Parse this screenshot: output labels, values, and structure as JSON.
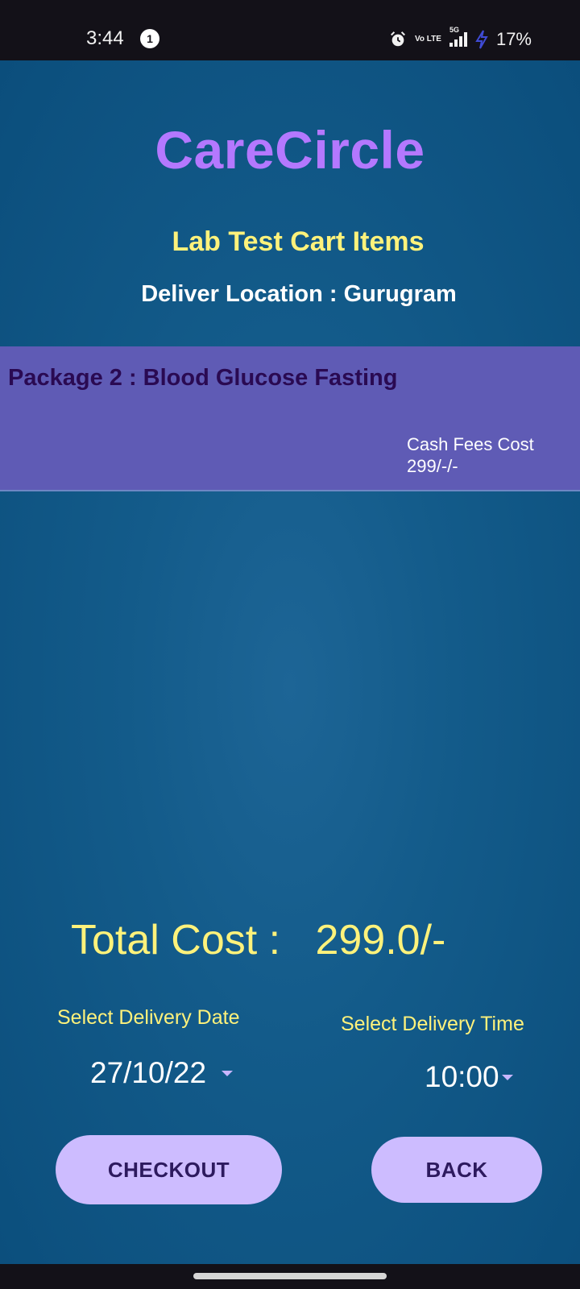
{
  "status_bar": {
    "time": "3:44",
    "notification_count": "1",
    "network_label": "5G",
    "volte_label": "Vo LTE",
    "battery": "17%"
  },
  "app": {
    "title": "CareCircle",
    "subtitle": "Lab Test Cart Items",
    "location": "Deliver Location : Gurugram"
  },
  "cart": {
    "items": [
      {
        "name": "Package 2 : Blood Glucose Fasting",
        "cost_label": "Cash Fees Cost",
        "cost_value": "299/-/-"
      }
    ]
  },
  "summary": {
    "total": "Total Cost :   299.0/-"
  },
  "delivery": {
    "date_label": "Select Delivery Date",
    "date_value": "27/10/22",
    "time_label": "Select Delivery Time",
    "time_value": "10:00"
  },
  "actions": {
    "checkout_label": "CHECKOUT",
    "back_label": "BACK"
  },
  "colors": {
    "title": "#b478ff",
    "accent_yellow": "#fff27b",
    "cart_item_bg": "#5f5bb5",
    "button_bg": "#cdbcff",
    "button_text": "#2d1a5e",
    "background": "#135b8a"
  }
}
